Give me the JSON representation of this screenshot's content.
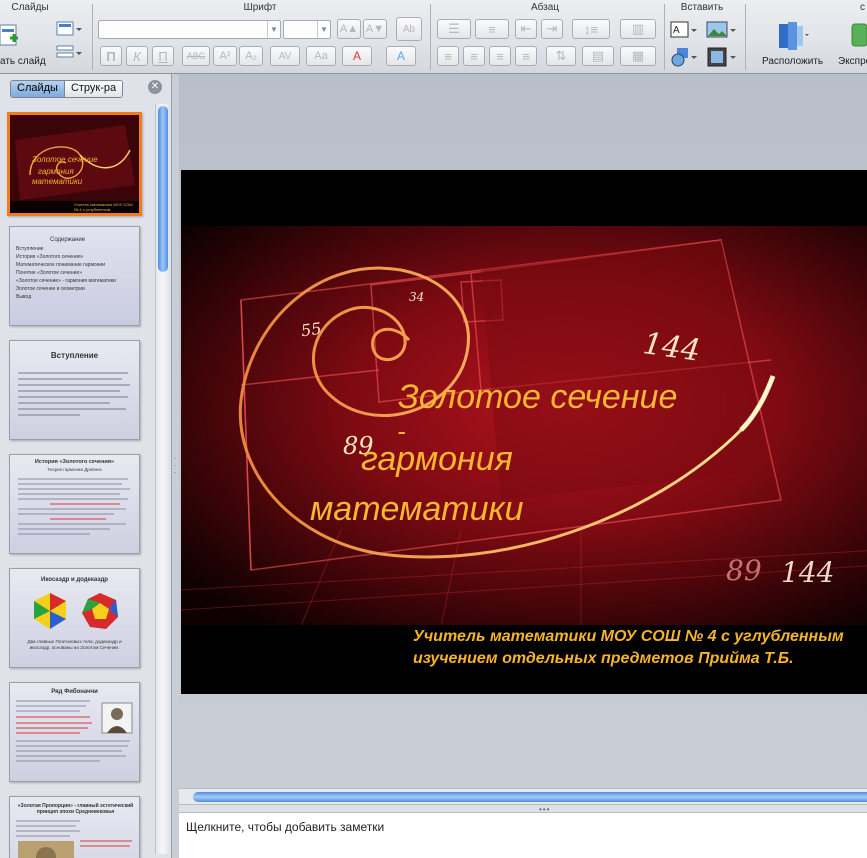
{
  "ribbon": {
    "groups": {
      "slides": "Слайды",
      "font": "Шрифт",
      "paragraph": "Абзац",
      "insert": "Вставить"
    },
    "new_slide_label": "ать слайд",
    "arrange_label": "Расположить",
    "express_label": "Экспре",
    "font_buttons": {
      "bold": "П",
      "italic": "К",
      "underline": "П",
      "strike": "ABC",
      "superscript": "A²",
      "subscript": "A₂",
      "spacing": "AV",
      "case": "Aa",
      "color": "A",
      "glow": "A",
      "grow": "A▲",
      "shrink": "A▼"
    }
  },
  "left_pane": {
    "tab_slides": "Слайды",
    "tab_outline": "Струк-ра",
    "thumbs": [
      {
        "title": "Золотое сечение - гармония математики",
        "selected": true
      },
      {
        "title": "Содержание",
        "items": [
          "Вступление",
          "История «Золотого сечения»",
          "Математическое понимание гармонии",
          "Понятие «Золотое сечение»",
          "«Золотое сечение» - гармония математики",
          "Золотое сечение в геометрии",
          "Вывод"
        ]
      },
      {
        "title": "Вступление"
      },
      {
        "title": "История «Золотого сечения»",
        "subtitle": "Теория гармонии Древних"
      },
      {
        "title": "Икосаэдр и додекаэдр",
        "caption": "Два главных Платоновых тела: додекаэдр и икосаэдр, основаны на Золотом Сечении."
      },
      {
        "title": "Ряд Фибоначчи"
      },
      {
        "title": "«Золотая Пропорция» - главный эстетический принцип эпохи Средневековья"
      }
    ]
  },
  "slide": {
    "title_line1": "Золотое сечение",
    "title_dash": "-",
    "title_line2": "гармония",
    "title_line3": "математики",
    "author_line1": "Учитель математики  МОУ СОШ № 4 с углубленным",
    "author_line2": "изучением отдельных предметов Прийма Т.Б.",
    "numbers": {
      "n34": "34",
      "n55": "55",
      "n89": "89",
      "n144": "144",
      "n89b": "89",
      "n144b": "144"
    }
  },
  "notes": {
    "placeholder": "Щелкните, чтобы добавить заметки"
  },
  "colors": {
    "selection_border": "#f07d1a",
    "title_text": "#f7b733",
    "author_text": "#f5b42a",
    "spiral": "#ffd36a"
  }
}
